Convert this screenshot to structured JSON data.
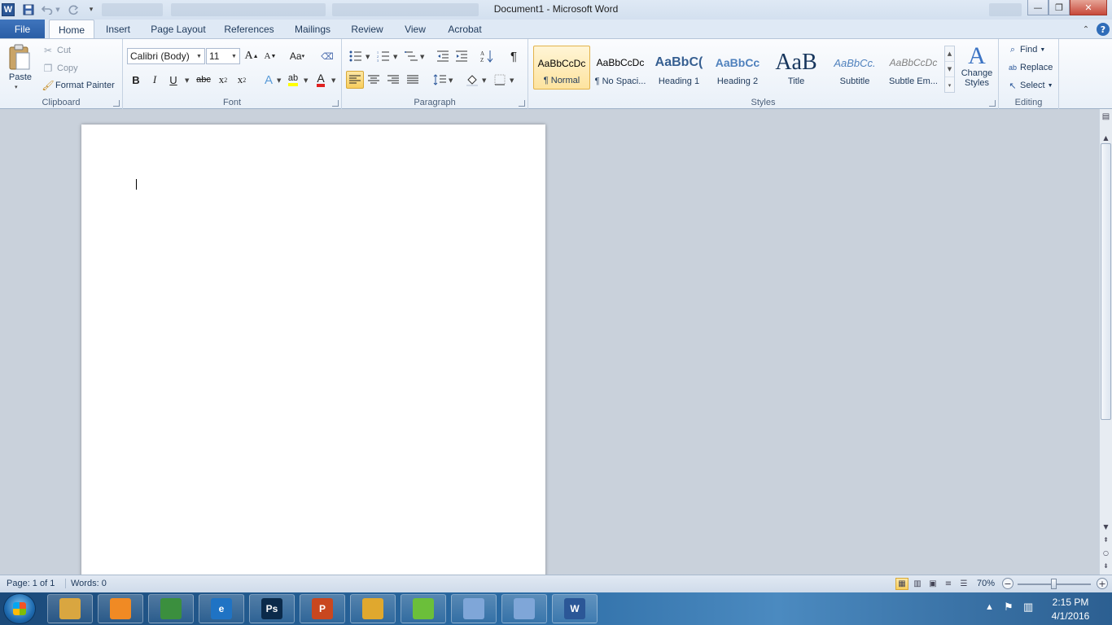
{
  "window": {
    "title": "Document1  -  Microsoft Word",
    "logo_letter": "W",
    "controls": {
      "minimize": "—",
      "restore": "❐",
      "close": "✕"
    }
  },
  "qat": {
    "save_icon": "save-icon",
    "undo_icon": "undo-icon",
    "redo_icon": "redo-icon",
    "customize_icon": "customize-qat-icon"
  },
  "tabs": {
    "file": "File",
    "items": [
      "Home",
      "Insert",
      "Page Layout",
      "References",
      "Mailings",
      "Review",
      "View",
      "Acrobat"
    ],
    "active": "Home"
  },
  "clipboard": {
    "paste": "Paste",
    "cut": "Cut",
    "copy": "Copy",
    "format_painter": "Format Painter",
    "label": "Clipboard"
  },
  "font": {
    "font_name": "Calibri (Body)",
    "font_size": "11",
    "grow": "A",
    "shrink": "A",
    "change_case": "Aa",
    "bold": "B",
    "italic": "I",
    "underline": "U",
    "strikethrough": "abc",
    "subscript": "x",
    "superscript": "x",
    "text_effects": "A",
    "highlight": "ab",
    "font_color": "A",
    "label": "Font"
  },
  "paragraph": {
    "pilcrow": "¶",
    "label": "Paragraph"
  },
  "styles": {
    "items": [
      {
        "preview": "AaBbCcDc",
        "name": "¶ Normal"
      },
      {
        "preview": "AaBbCcDc",
        "name": "¶ No Spaci..."
      },
      {
        "preview": "AaBbC(",
        "name": "Heading 1"
      },
      {
        "preview": "AaBbCc",
        "name": "Heading 2"
      },
      {
        "preview": "AaB",
        "name": "Title"
      },
      {
        "preview": "AaBbCc.",
        "name": "Subtitle"
      },
      {
        "preview": "AaBbCcDc",
        "name": "Subtle Em..."
      }
    ],
    "change_styles_line1": "Change",
    "change_styles_line2": "Styles",
    "label": "Styles"
  },
  "editing": {
    "find": "Find",
    "replace": "Replace",
    "select": "Select",
    "label": "Editing"
  },
  "status": {
    "page": "Page: 1 of 1",
    "words": "Words: 0",
    "zoom": "70%",
    "zoom_fraction": 0.5
  },
  "taskbar": {
    "apps": [
      {
        "name": "file-explorer",
        "letter": "",
        "color": "#d9a640"
      },
      {
        "name": "media-player",
        "letter": "",
        "color": "#f08a24"
      },
      {
        "name": "chrome",
        "letter": "",
        "color": "#3b8f3e"
      },
      {
        "name": "internet-explorer",
        "letter": "e",
        "color": "#1f73c4"
      },
      {
        "name": "photoshop",
        "letter": "Ps",
        "color": "#0b2a4a"
      },
      {
        "name": "powerpoint",
        "letter": "P",
        "color": "#c9471f"
      },
      {
        "name": "winamp",
        "letter": "",
        "color": "#e0a82e"
      },
      {
        "name": "camtasia",
        "letter": "",
        "color": "#6bbf3a"
      },
      {
        "name": "acrobat-app-1",
        "letter": "",
        "color": "#7fa6d8"
      },
      {
        "name": "acrobat-app-2",
        "letter": "",
        "color": "#7fa6d8"
      },
      {
        "name": "word",
        "letter": "W",
        "color": "#2b5797"
      }
    ],
    "time": "2:15 PM",
    "date": "4/1/2016"
  }
}
